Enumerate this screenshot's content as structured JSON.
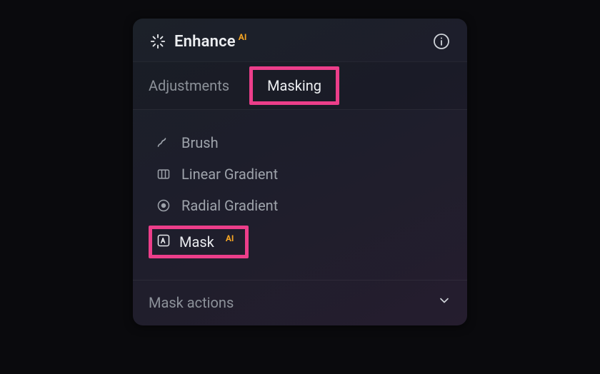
{
  "header": {
    "title": "Enhance",
    "ai_badge": "AI",
    "info_aria": "Info"
  },
  "tabs": {
    "adjustments": "Adjustments",
    "masking": "Masking"
  },
  "tools": {
    "brush": "Brush",
    "linear_gradient": "Linear Gradient",
    "radial_gradient": "Radial Gradient",
    "mask_ai": "Mask",
    "mask_ai_badge": "AI"
  },
  "actions": {
    "label": "Mask actions"
  },
  "highlight_color": "#ec3e8a",
  "accent_ai": "#f6a623"
}
